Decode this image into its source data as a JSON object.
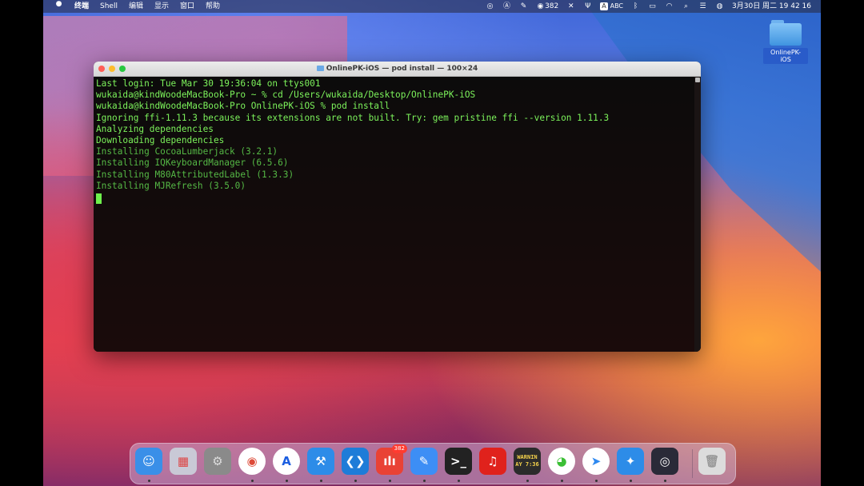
{
  "menubar": {
    "apple": "",
    "items": [
      "终端",
      "Shell",
      "编辑",
      "显示",
      "窗口",
      "帮助"
    ],
    "status": {
      "notification_count": "382",
      "input_method": "ABC",
      "datetime": "3月30日 周二  19 42 16"
    }
  },
  "desktop": {
    "folder_label": "OnlinePK-iOS"
  },
  "terminal": {
    "title": "OnlinePK-iOS — pod install — 100×24",
    "lines": [
      {
        "text": "Last login: Tue Mar 30 19:36:04 on ttys001",
        "style": "bright"
      },
      {
        "text": "wukaida@kindWoodeMacBook-Pro ~ % cd /Users/wukaida/Desktop/OnlinePK-iOS",
        "style": "bright"
      },
      {
        "text": "wukaida@kindWoodeMacBook-Pro OnlinePK-iOS % pod install",
        "style": "bright"
      },
      {
        "text": "Ignoring ffi-1.11.3 because its extensions are not built. Try: gem pristine ffi --version 1.11.3",
        "style": "bright"
      },
      {
        "text": "Analyzing dependencies",
        "style": "bright"
      },
      {
        "text": "Downloading dependencies",
        "style": "bright"
      },
      {
        "text": "Installing CocoaLumberjack (3.2.1)",
        "style": "dim"
      },
      {
        "text": "Installing IQKeyboardManager (6.5.6)",
        "style": "dim"
      },
      {
        "text": "Installing M80AttributedLabel (1.3.3)",
        "style": "dim"
      },
      {
        "text": "Installing MJRefresh (3.5.0)",
        "style": "dim"
      }
    ]
  },
  "dock": {
    "apps": [
      {
        "icon": "finder-icon",
        "color": "#3a8fe8",
        "running": true
      },
      {
        "icon": "launchpad-icon",
        "color": "#c9c9d6",
        "running": false
      },
      {
        "icon": "system-preferences-icon",
        "color": "#8a8a8a",
        "running": false
      },
      {
        "icon": "chrome-icon",
        "color": "#ffffff",
        "running": true
      },
      {
        "icon": "pycharm-ai-icon",
        "color": "#ffffff",
        "running": true
      },
      {
        "icon": "xcode-icon",
        "color": "#2d8ce8",
        "running": true
      },
      {
        "icon": "vscode-icon",
        "color": "#1e7cd8",
        "running": true
      },
      {
        "icon": "ding-icon",
        "color": "#e94235",
        "running": true,
        "badge": "382"
      },
      {
        "icon": "pen-icon",
        "color": "#3d8ef5",
        "running": true
      },
      {
        "icon": "terminal-icon",
        "color": "#222222",
        "running": true
      },
      {
        "icon": "netease-music-icon",
        "color": "#e0221c",
        "running": false
      },
      {
        "icon": "console-icon",
        "color": "#2b2b2b",
        "running": true,
        "text": "WARNIN\nAY 7:36"
      },
      {
        "icon": "wechat-icon",
        "color": "#ffffff",
        "running": true
      },
      {
        "icon": "paper-plane-icon",
        "color": "#ffffff",
        "running": true
      },
      {
        "icon": "simulator-icon",
        "color": "#2d8ce8",
        "running": true
      },
      {
        "icon": "obs-icon",
        "color": "#2a2a38",
        "running": true
      },
      {
        "icon": "trash-icon",
        "color": "#dcdcdc",
        "running": false
      }
    ]
  }
}
